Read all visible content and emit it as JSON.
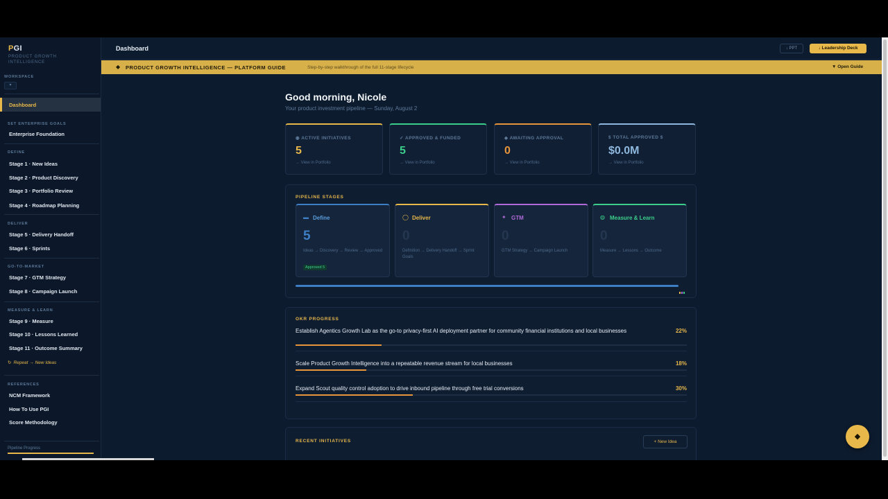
{
  "brand": {
    "logo_a": "P",
    "logo_b": "GI",
    "subtitle": "PRODUCT GROWTH INTELLIGENCE"
  },
  "sidebar": {
    "workspace_label": "WORKSPACE",
    "workspace_value": "▾",
    "active_item": "Dashboard",
    "sections": [
      {
        "label": "SET ENTERPRISE GOALS",
        "items": [
          "Enterprise Foundation"
        ]
      },
      {
        "label": "DEFINE",
        "items": [
          "Stage 1 · New Ideas",
          "Stage 2 · Product Discovery",
          "Stage 3 · Portfolio Review",
          "Stage 4 · Roadmap Planning"
        ]
      },
      {
        "label": "DELIVER",
        "items": [
          "Stage 5 · Delivery Handoff",
          "Stage 6 · Sprints"
        ]
      },
      {
        "label": "GO-TO-MARKET",
        "items": [
          "Stage 7 · GTM Strategy",
          "Stage 8 · Campaign Launch"
        ]
      },
      {
        "label": "MEASURE & LEARN",
        "items": [
          "Stage 9 · Measure",
          "Stage 10 · Lessons Learned",
          "Stage 11 · Outcome Summary"
        ]
      },
      {
        "label": "REFERENCES",
        "items": [
          "NCM Framework",
          "How To Use PGI",
          "Score Methodology"
        ]
      }
    ],
    "repeat_label": "Repeat → New Ideas",
    "pipeline_progress_label": "Pipeline Progress"
  },
  "topbar": {
    "title": "Dashboard",
    "ppt_label": "↓ PPT",
    "deck_label": "↓ Leadership Deck"
  },
  "guide": {
    "icon": "◆",
    "title": "PRODUCT GROWTH INTELLIGENCE — PLATFORM GUIDE",
    "subtitle": "Step-by-step walkthrough of the full 11-stage lifecycle",
    "open_label": "▼ Open Guide"
  },
  "main": {
    "greeting": "Good morning, Nicole",
    "subtitle": "Your product investment pipeline — Sunday, August 2",
    "stats": [
      {
        "label": "◉ ACTIVE INITIATIVES",
        "value": "5",
        "link": "→ View in Portfolio",
        "color": "#e8b84a"
      },
      {
        "label": "✓ APPROVED & FUNDED",
        "value": "5",
        "link": "→ View in Portfolio",
        "color": "#3ccf8b"
      },
      {
        "label": "◆ AWAITING APPROVAL",
        "value": "0",
        "link": "→ View in Portfolio",
        "color": "#e8943a"
      },
      {
        "label": "$ TOTAL APPROVED $",
        "value": "$0.0M",
        "link": "→ View in Portfolio",
        "color": "#8fb8de"
      }
    ],
    "pipeline": {
      "title": "PIPELINE STAGES",
      "stages": [
        {
          "icon": "▬",
          "name": "Define",
          "count": "5",
          "desc": "Ideas → Discovery → Review → Approved",
          "badge": "Approved 5",
          "color": "#3d7ec4"
        },
        {
          "icon": "◯",
          "name": "Deliver",
          "count": "0",
          "desc": "Definition → Delivery Handoff → Sprint Goals",
          "badge": "",
          "color": "#e8b84a"
        },
        {
          "icon": "✦",
          "name": "GTM",
          "count": "0",
          "desc": "GTM Strategy → Campaign Launch",
          "badge": "",
          "color": "#b06ad8"
        },
        {
          "icon": "◍",
          "name": "Measure & Learn",
          "count": "0",
          "desc": "Measure → Lessons → Outcome",
          "badge": "",
          "color": "#3ccf8b"
        }
      ]
    },
    "okr": {
      "title": "OKR PROGRESS",
      "items": [
        {
          "text": "Establish Agentics Growth Lab as the go-to privacy-first AI deployment partner for community financial institutions and local businesses",
          "pct": "22%",
          "progress": 0.22
        },
        {
          "text": "Scale Product Growth Intelligence into a repeatable revenue stream for local businesses",
          "pct": "18%",
          "progress": 0.18
        },
        {
          "text": "Expand Scout quality control adoption to drive inbound pipeline through free trial conversions",
          "pct": "30%",
          "progress": 0.3
        }
      ]
    },
    "recent": {
      "title": "RECENT INITIATIVES",
      "new_label": "+ New Idea"
    },
    "fab_icon": "◆"
  }
}
